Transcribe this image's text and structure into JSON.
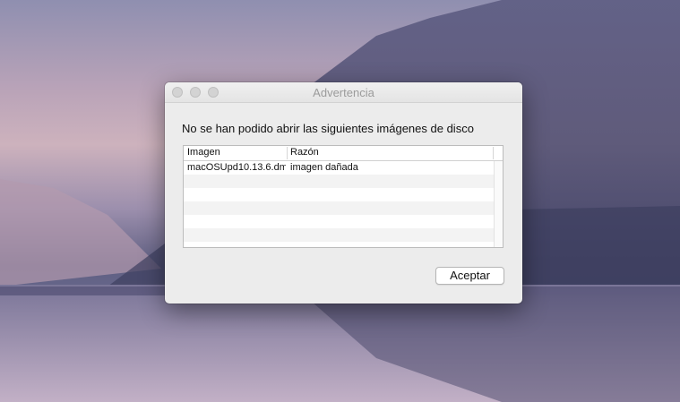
{
  "dialog": {
    "title": "Advertencia",
    "message": "No se han podido abrir las siguientes imágenes de disco",
    "columns": [
      "Imagen",
      "Razón"
    ],
    "rows": [
      {
        "image": "macOSUpd10.13.6.dm",
        "reason": "imagen dañada"
      },
      {
        "image": "",
        "reason": ""
      },
      {
        "image": "",
        "reason": ""
      },
      {
        "image": "",
        "reason": ""
      },
      {
        "image": "",
        "reason": ""
      },
      {
        "image": "",
        "reason": ""
      }
    ],
    "accept_label": "Aceptar"
  }
}
